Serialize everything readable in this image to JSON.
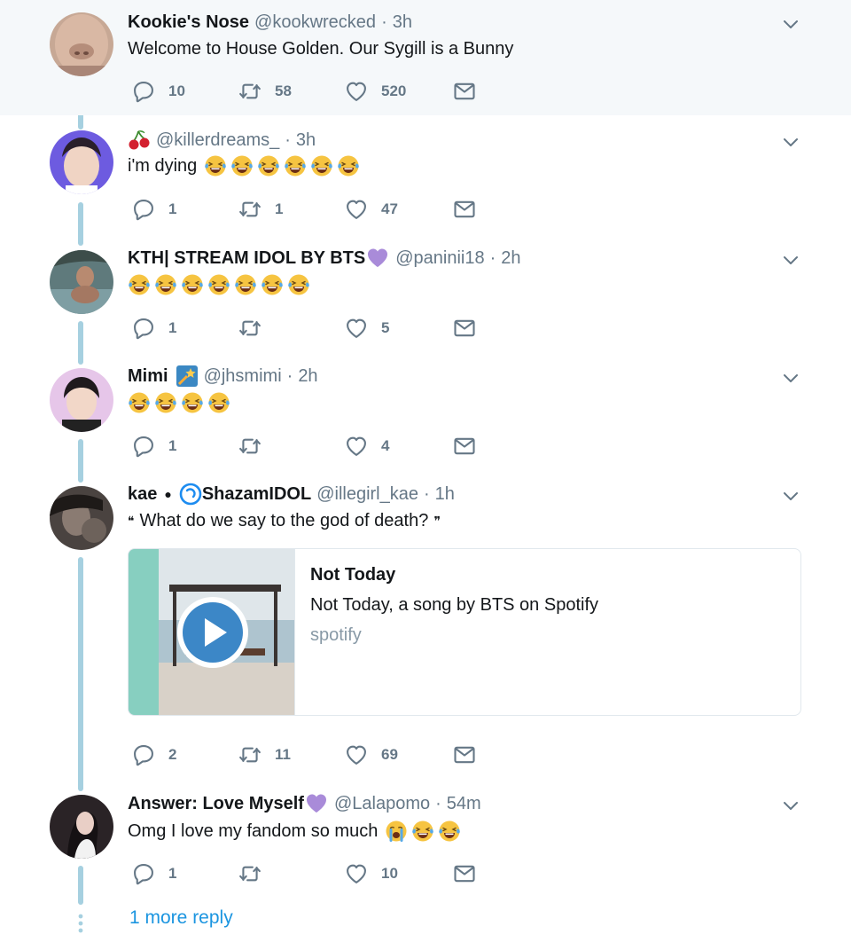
{
  "colors": {
    "accent": "#1b95e0",
    "muted": "#657786",
    "thread_line": "#a6d0e0",
    "heart": "#657786",
    "highlight_bg": "#f5f8fa"
  },
  "tweets": [
    {
      "name": "Kookie's Nose",
      "handle": "@kookwrecked",
      "separator": "·",
      "time": "3h",
      "text": "Welcome to House Golden. Our Sygill is a Bunny",
      "replies": "10",
      "retweets": "58",
      "likes": "520"
    },
    {
      "name": "",
      "name_icon": "cherry-icon",
      "handle": "@killerdreams_",
      "separator": "·",
      "time": "3h",
      "text": "i'm dying",
      "emojis": [
        "laughing-tears-emoji",
        "laughing-tears-emoji",
        "laughing-tears-emoji",
        "laughing-tears-emoji",
        "laughing-tears-emoji",
        "laughing-tears-emoji"
      ],
      "replies": "1",
      "retweets": "1",
      "likes": "47"
    },
    {
      "name": "KTH| STREAM IDOL BY BTS",
      "name_icon": "purple-heart-icon",
      "handle": "@paninii18",
      "separator": "·",
      "time": "2h",
      "text": "",
      "emojis": [
        "laughing-tears-emoji",
        "laughing-tears-emoji",
        "laughing-tears-emoji",
        "laughing-tears-emoji",
        "laughing-tears-emoji",
        "laughing-tears-emoji",
        "laughing-tears-emoji"
      ],
      "replies": "1",
      "retweets": "",
      "likes": "5"
    },
    {
      "name": "Mimi",
      "name_icon": "shooting-star-icon",
      "handle": "@jhsmimi",
      "separator": "·",
      "time": "2h",
      "text": "",
      "emojis": [
        "laughing-tears-emoji",
        "laughing-tears-emoji",
        "laughing-tears-emoji",
        "laughing-tears-emoji"
      ],
      "replies": "1",
      "retweets": "",
      "likes": "4"
    },
    {
      "name": "kae",
      "name_bullet": "●",
      "name_extra": "ShazamIDOL",
      "name_icon": "shazam-icon",
      "handle": "@illegirl_kae",
      "separator": "·",
      "time": "1h",
      "text_open_quote": "❝",
      "text": "What do we say to the god of death?",
      "text_close_quote": "❞",
      "card": {
        "title": "Not Today",
        "description": "Not Today, a song by BTS on Spotify",
        "domain": "spotify"
      },
      "replies": "2",
      "retweets": "11",
      "likes": "69"
    },
    {
      "name": "Answer: Love Myself",
      "name_icon": "purple-heart-icon",
      "handle": "@Lalapomo",
      "separator": "·",
      "time": "54m",
      "text": "Omg I love my fandom so much",
      "emojis": [
        "crying-emoji",
        "laughing-tears-emoji",
        "laughing-tears-emoji"
      ],
      "replies": "1",
      "retweets": "",
      "likes": "10"
    }
  ],
  "more_replies": "1 more reply"
}
